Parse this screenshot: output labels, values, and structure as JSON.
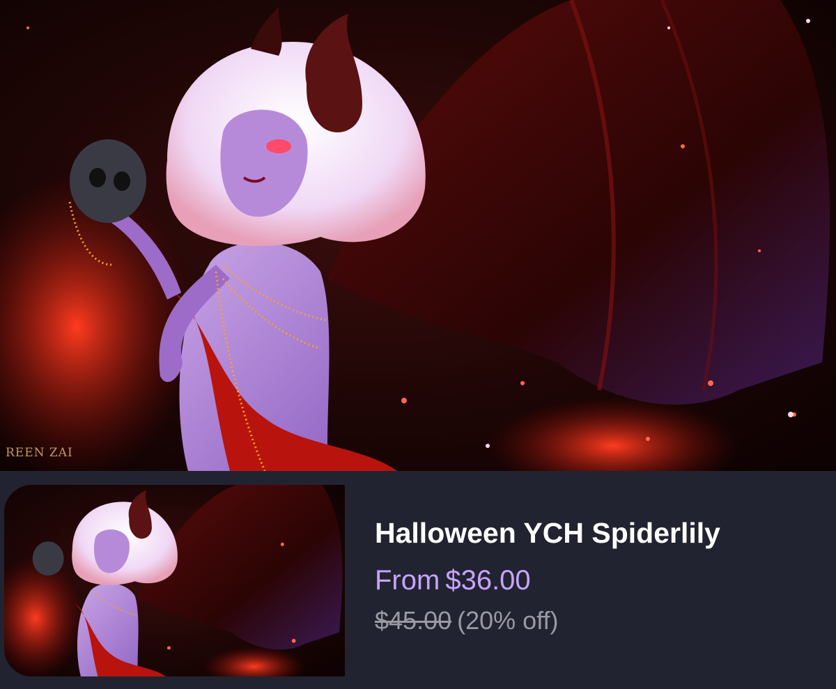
{
  "artwork": {
    "watermark": "REEN ZAI"
  },
  "listing": {
    "title": "Halloween YCH Spiderlily",
    "price_prefix": "From",
    "price": "$36.00",
    "original_price": "$45.00",
    "discount": "(20% off)"
  },
  "colors": {
    "background": "#222330",
    "price_accent": "#c7a4ff",
    "muted_text": "#9a9aa3"
  }
}
